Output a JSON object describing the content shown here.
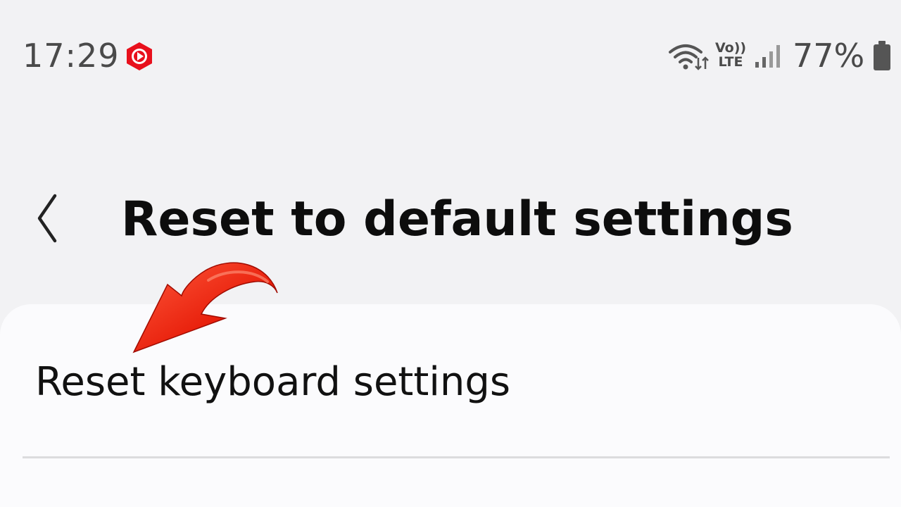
{
  "status_bar": {
    "time": "17:29",
    "volte_top": "Vo))",
    "volte_bottom": "LTE",
    "battery_percent": "77%",
    "icons": [
      "youtube-recording-icon",
      "wifi-icon",
      "volte-icon",
      "signal-icon",
      "battery-icon"
    ],
    "recording_color": "#e8101c"
  },
  "header": {
    "back_icon": "chevron-left-icon",
    "title": "Reset to default settings"
  },
  "list": {
    "items": [
      {
        "label": "Reset keyboard settings"
      }
    ]
  },
  "overlay": {
    "arrow_icon": "red-curved-arrow-icon",
    "arrow_color": "#e8200c"
  }
}
